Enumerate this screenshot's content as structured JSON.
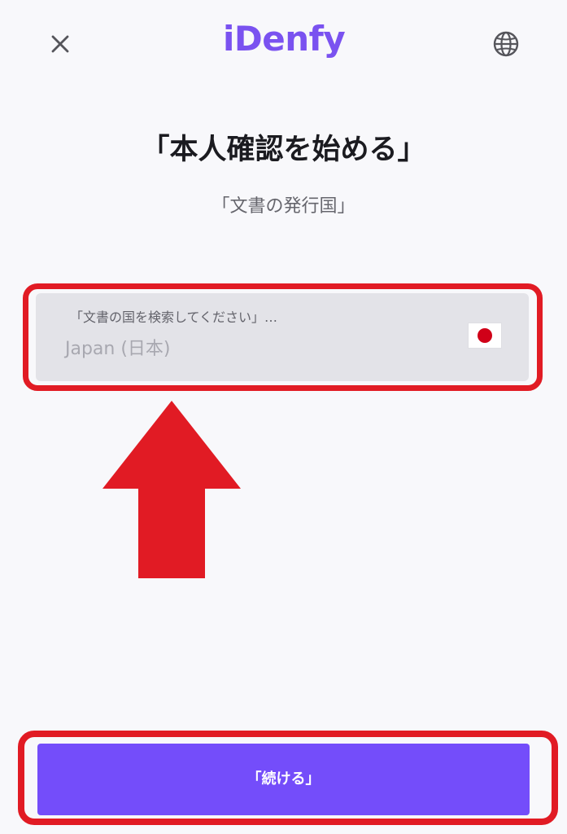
{
  "header": {
    "logo_text": "iDenfy",
    "close_icon": "close-icon",
    "language_icon": "globe-icon"
  },
  "main": {
    "title": "「本人確認を始める」",
    "subtitle": "「文書の発行国」",
    "country_field": {
      "label": "「文書の国を検索してください」…",
      "value": "Japan (日本)",
      "flag_icon": "japan-flag-icon"
    }
  },
  "footer": {
    "continue_label": "「続ける」"
  },
  "colors": {
    "brand": "#744dfa",
    "annotation": "#e11b24",
    "field_background": "#e3e3e8"
  },
  "annotation": {
    "arrow_icon": "up-arrow-icon"
  }
}
